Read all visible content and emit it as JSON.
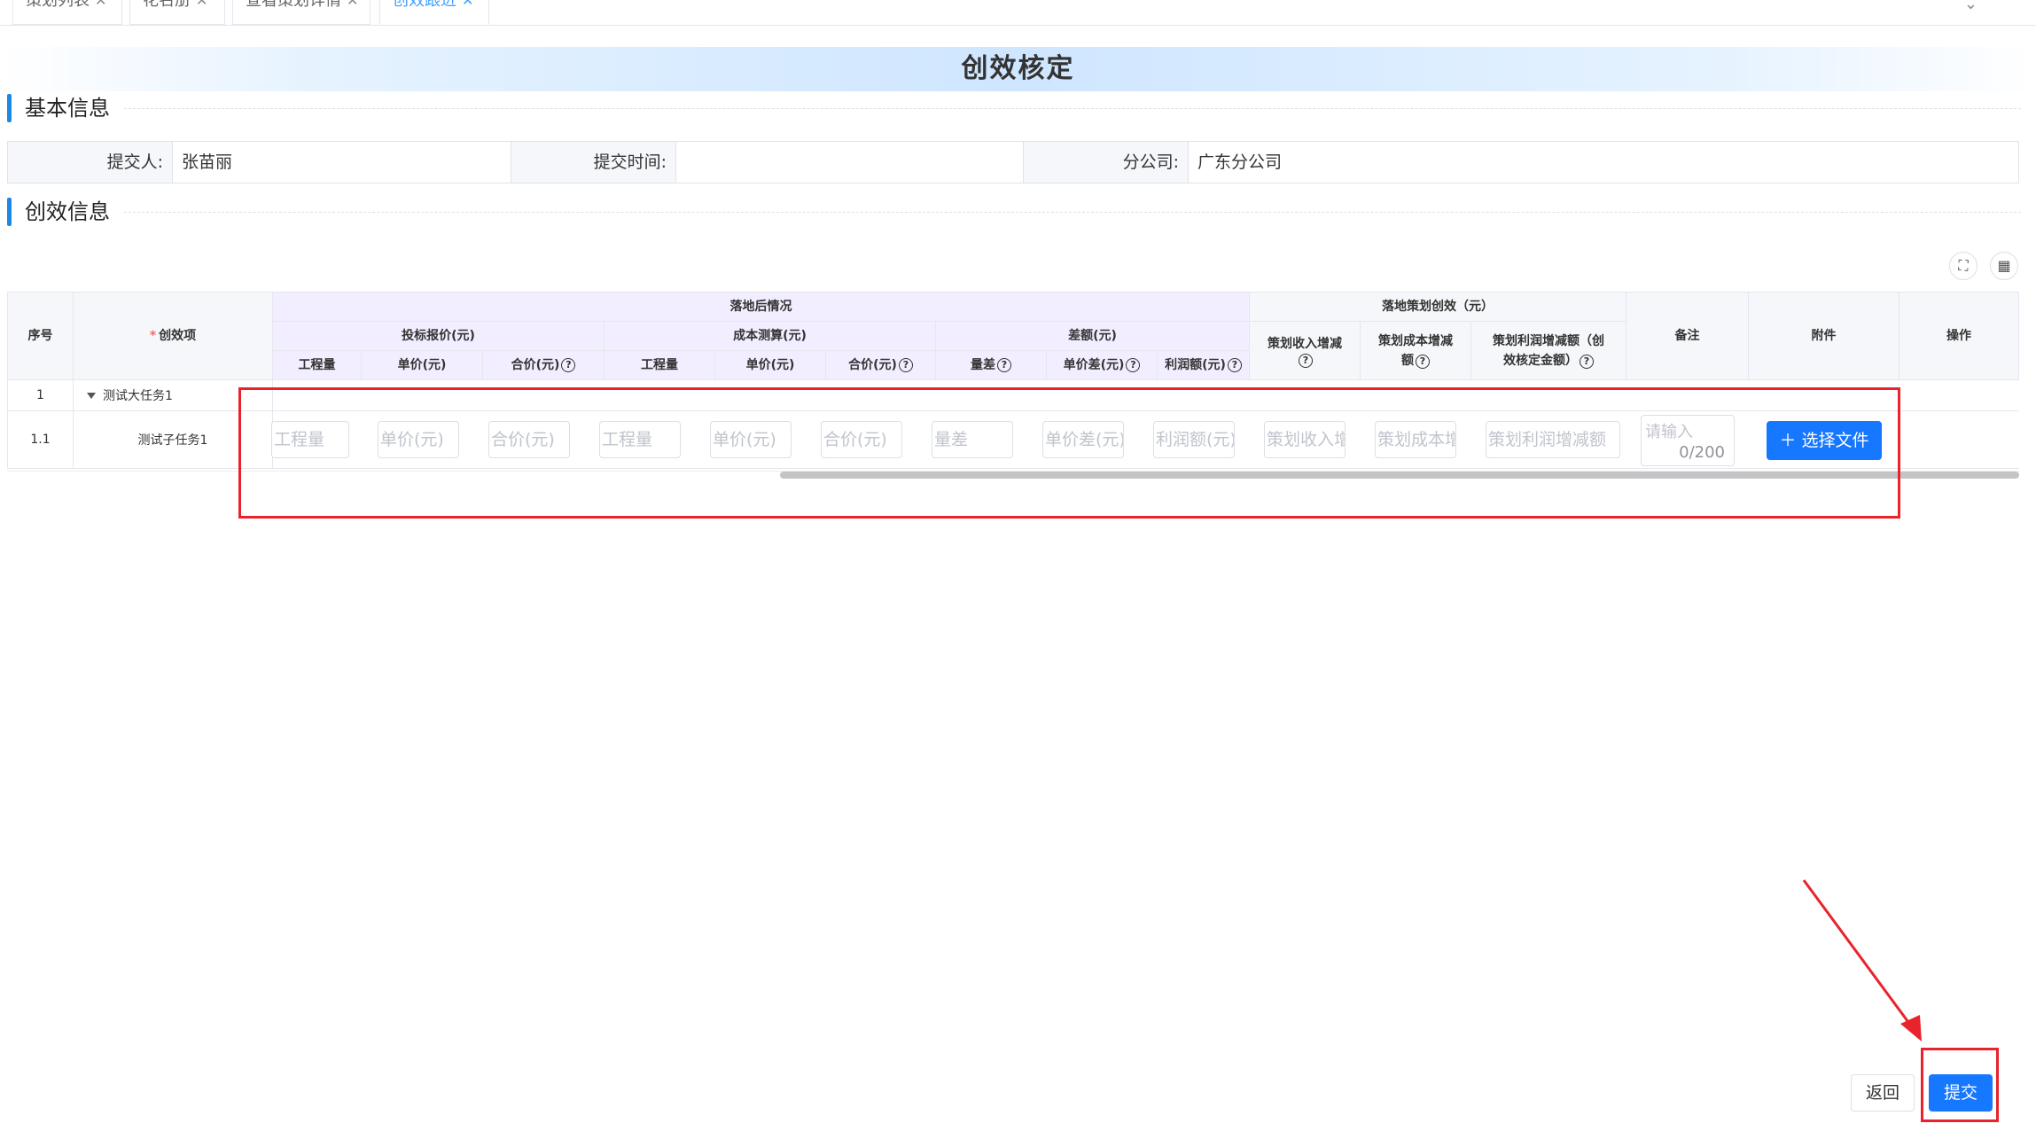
{
  "tabs": [
    {
      "label": "策划列表"
    },
    {
      "label": "花名册"
    },
    {
      "label": "查看策划详情"
    },
    {
      "label": "创效跟进"
    }
  ],
  "page_title": "创效核定",
  "basic_section": {
    "title": "基本信息",
    "submitter_label": "提交人:",
    "submitter_value": "张苗丽",
    "submit_time_label": "提交时间:",
    "submit_time_value": "",
    "branch_label": "分公司:",
    "branch_value": "广东分公司"
  },
  "benefit_section": {
    "title": "创效信息"
  },
  "toolbar": {
    "fullscreen_icon": "fullscreen-icon",
    "columns_icon": "grid-icon"
  },
  "table": {
    "headers": {
      "seq": "序号",
      "item": "创效项",
      "after_landing": "落地后情况",
      "bid_quote": "投标报价(元)",
      "cost_estimate": "成本测算(元)",
      "difference": "差额(元)",
      "quantity": "工程量",
      "unit_price": "单价(元)",
      "total_price": "合价(元)",
      "qty_diff": "量差",
      "unit_price_diff": "单价差(元)",
      "profit": "利润额(元)",
      "planning_benefit": "落地策划创效（元）",
      "income_increase": "策划收入增减",
      "cost_increase_1": "策划成本增减",
      "cost_increase_2": "额",
      "profit_increase_1": "策划利润增减额（创",
      "profit_increase_2": "效核定金额）",
      "remark": "备注",
      "attachment": "附件",
      "action": "操作"
    },
    "rows": [
      {
        "seq": "1",
        "name": "测试大任务1"
      },
      {
        "seq": "1.1",
        "name": "测试子任务1"
      }
    ],
    "placeholders": {
      "quantity": "工程量",
      "unit_price": "单价(元)",
      "total_price": "合价(元)",
      "qty_diff": "量差",
      "unit_price_diff": "单价差(元)",
      "profit": "利润额(元)",
      "income_increase": "策划收入增",
      "cost_increase": "策划成本增",
      "profit_increase": "策划利润增减额",
      "remark": "请输入",
      "remark_count": "0/200"
    },
    "select_file_label": "选择文件"
  },
  "footer": {
    "back_label": "返回",
    "submit_label": "提交"
  },
  "annotation_color": "#e8232b",
  "accent_color": "#1677ff"
}
